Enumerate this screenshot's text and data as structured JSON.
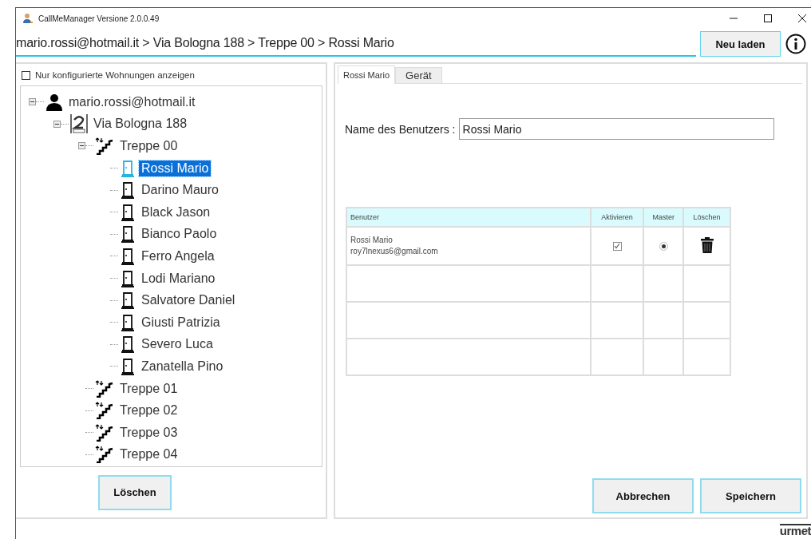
{
  "window": {
    "title": "CallMeManager Versione 2.0.0.49"
  },
  "breadcrumb": "mario.rossi@hotmail.it > Via Bologna 188 > Treppe 00 > Rossi Mario",
  "reload_button": "Neu laden",
  "filter": {
    "label": "Nur konfigurierte Wohnungen anzeigen",
    "checked": false
  },
  "tree": [
    {
      "kind": "account",
      "label": "mario.rossi@hotmail.it",
      "selected": false,
      "expanded": true,
      "children": [
        {
          "kind": "building",
          "label": "Via Bologna 188",
          "selected": false,
          "expanded": true,
          "children": [
            {
              "kind": "stair",
              "label": "Treppe 00",
              "selected": false,
              "expanded": true,
              "children": [
                {
                  "kind": "apartment",
                  "label": "Rossi Mario",
                  "selected": true
                },
                {
                  "kind": "apartment",
                  "label": "Darino Mauro",
                  "selected": false
                },
                {
                  "kind": "apartment",
                  "label": "Black Jason",
                  "selected": false
                },
                {
                  "kind": "apartment",
                  "label": "Bianco Paolo",
                  "selected": false
                },
                {
                  "kind": "apartment",
                  "label": "Ferro Angela",
                  "selected": false
                },
                {
                  "kind": "apartment",
                  "label": "Lodi Mariano",
                  "selected": false
                },
                {
                  "kind": "apartment",
                  "label": "Salvatore Daniel",
                  "selected": false
                },
                {
                  "kind": "apartment",
                  "label": "Giusti Patrizia",
                  "selected": false
                },
                {
                  "kind": "apartment",
                  "label": "Severo Luca",
                  "selected": false
                },
                {
                  "kind": "apartment",
                  "label": "Zanatella Pino",
                  "selected": false
                }
              ]
            },
            {
              "kind": "stair",
              "label": "Treppe 01",
              "selected": false
            },
            {
              "kind": "stair",
              "label": "Treppe 02",
              "selected": false
            },
            {
              "kind": "stair",
              "label": "Treppe 03",
              "selected": false
            },
            {
              "kind": "stair",
              "label": "Treppe 04",
              "selected": false
            }
          ]
        }
      ]
    }
  ],
  "delete_button": "Löschen",
  "tabs": [
    {
      "label": "Rossi Mario",
      "selected": true
    },
    {
      "label": "Gerät",
      "selected": false
    }
  ],
  "name_field": {
    "label": "Name des Benutzers :",
    "value": "Rossi Mario"
  },
  "users_table": {
    "columns": [
      "Benutzer",
      "Aktivieren",
      "Master",
      "Löschen"
    ],
    "rows": [
      {
        "name": "Rossi Mario",
        "email": "roy7lnexus6@gmail.com",
        "active": true,
        "master": true
      }
    ]
  },
  "cancel_button": "Abbrechen",
  "save_button": "Speichern",
  "logo": "urmet"
}
